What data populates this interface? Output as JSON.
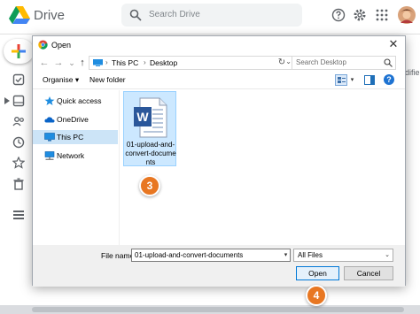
{
  "drive": {
    "app_title": "Drive",
    "search_placeholder": "Search Drive",
    "modified_partial": "odifie",
    "icons": [
      "drive-logo",
      "search-icon",
      "help-icon",
      "settings-icon",
      "apps-icon",
      "new-plus-icon",
      "priority-icon",
      "my-drive-icon",
      "shared-icon",
      "recent-icon",
      "starred-icon",
      "trash-icon",
      "storage-icon"
    ]
  },
  "dialog": {
    "title": "Open",
    "close_glyph": "✕",
    "nav": {
      "back_glyph": "←",
      "forward_glyph": "→",
      "recent_glyph": "⌄",
      "up_glyph": "↑",
      "crumbs": [
        "This PC",
        "Desktop"
      ],
      "crumb_separator": "›",
      "dropdown_glyph": "⌄",
      "refresh_glyph": "↻",
      "search_placeholder": "Search Desktop"
    },
    "toolbar": {
      "organise_label": "Organise ▾",
      "new_folder_label": "New folder",
      "view_dropdown_glyph": "▾",
      "help_glyph": "?"
    },
    "nav_items": [
      {
        "label": "Quick access",
        "icon": "star-icon"
      },
      {
        "label": "OneDrive",
        "icon": "cloud-icon"
      },
      {
        "label": "This PC",
        "icon": "monitor-icon",
        "selected": true
      },
      {
        "label": "Network",
        "icon": "network-icon"
      }
    ],
    "file": {
      "name": "01-upload-and-convert-documents",
      "icon": "word-document-icon",
      "icon_letter": "W"
    },
    "footer": {
      "file_name_label": "File name:",
      "file_name_value": "01-upload-and-convert-documents",
      "file_name_dropdown_glyph": "▾",
      "file_type_value": "All Files",
      "file_type_arrow": "⌄",
      "open_label": "Open",
      "cancel_label": "Cancel"
    }
  },
  "steps": {
    "three": "3",
    "four": "4"
  },
  "colors": {
    "step_orange": "#e87722",
    "selection_blue": "#cce8ff",
    "word_blue": "#2b579a",
    "accent_blue": "#0078d7"
  }
}
